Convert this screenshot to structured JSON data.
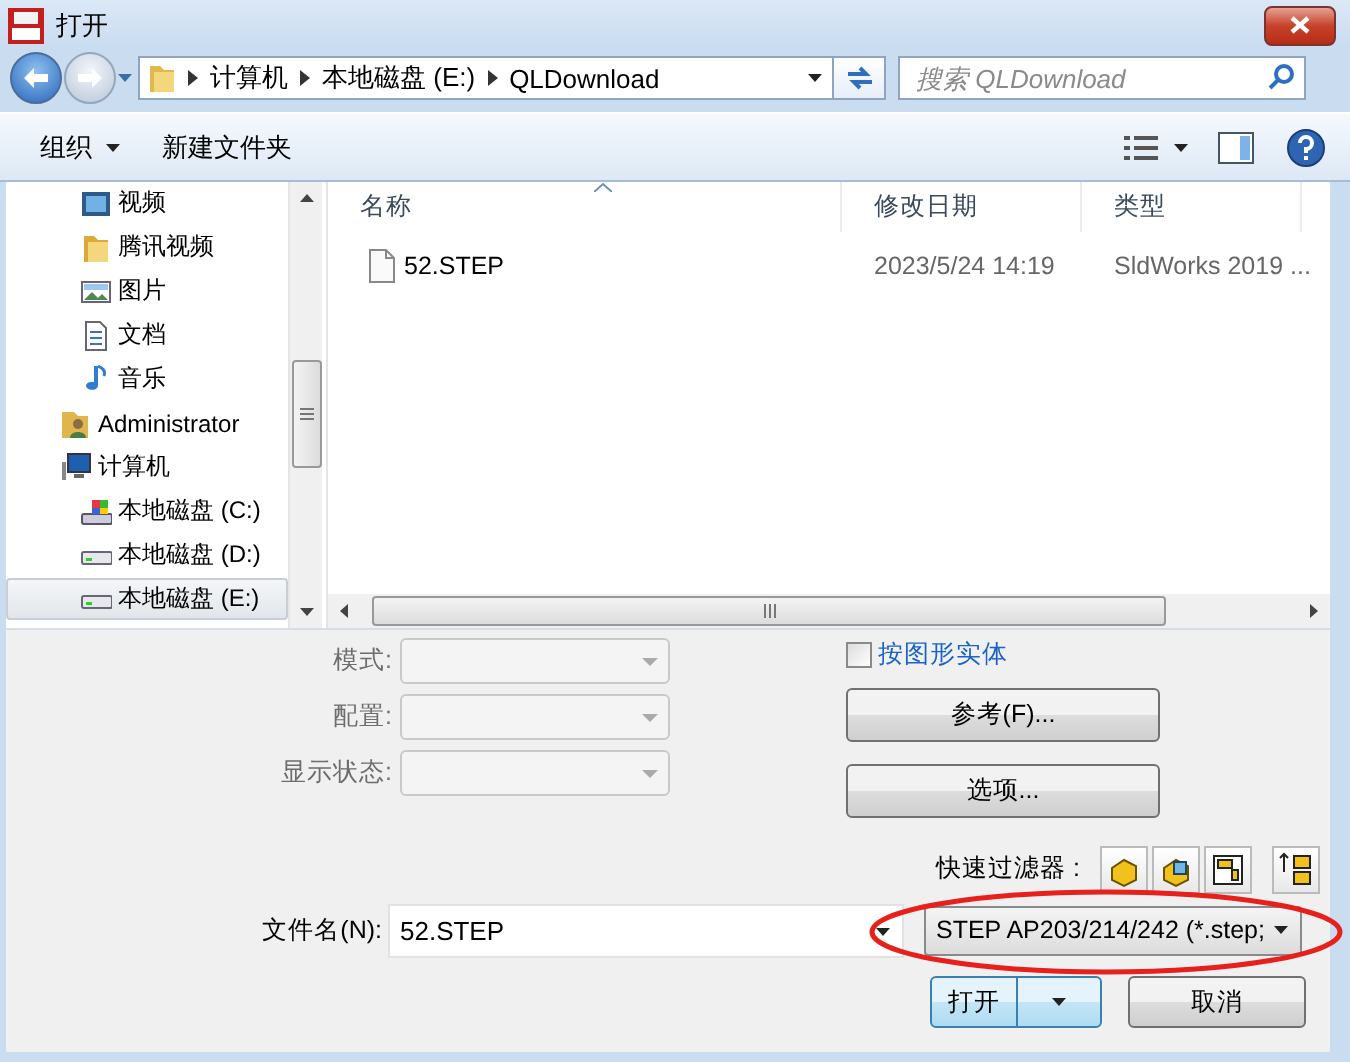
{
  "window": {
    "title": "打开"
  },
  "address": {
    "crumbs": [
      "计算机",
      "本地磁盘 (E:)",
      "QLDownload"
    ]
  },
  "search": {
    "placeholder": "搜索 QLDownload"
  },
  "toolbar": {
    "organize": "组织",
    "new_folder": "新建文件夹"
  },
  "sidebar": {
    "library_items": [
      {
        "label": "视频",
        "kind": "video",
        "selected": false
      },
      {
        "label": "腾讯视频",
        "kind": "folder",
        "selected": false
      },
      {
        "label": "图片",
        "kind": "pictures",
        "selected": false
      },
      {
        "label": "文档",
        "kind": "documents",
        "selected": false
      },
      {
        "label": "音乐",
        "kind": "music",
        "selected": false
      }
    ],
    "items": [
      {
        "label": "Administrator",
        "kind": "user",
        "selected": false
      },
      {
        "label": "计算机",
        "kind": "computer",
        "selected": false,
        "children": [
          {
            "label": "本地磁盘 (C:)",
            "kind": "system-drive",
            "selected": false
          },
          {
            "label": "本地磁盘 (D:)",
            "kind": "drive",
            "selected": false
          },
          {
            "label": "本地磁盘 (E:)",
            "kind": "drive",
            "selected": true
          }
        ]
      }
    ]
  },
  "file_list": {
    "columns": [
      "名称",
      "修改日期",
      "类型"
    ],
    "rows": [
      {
        "cells": [
          "52.STEP",
          "2023/5/24 14:19",
          "SldWorks 2019 ..."
        ]
      }
    ]
  },
  "options": {
    "fields": [
      {
        "label": "模式:",
        "disabled": true
      },
      {
        "label": "配置:",
        "disabled": true
      },
      {
        "label": "显示状态:",
        "disabled": true
      }
    ],
    "checkbox": {
      "label": "按图形实体",
      "checked": false
    },
    "buttons": [
      "参考(F)...",
      "选项..."
    ],
    "quick_filter": {
      "label": "快速过滤器 :"
    }
  },
  "filename": {
    "label": "文件名(N):",
    "value": "52.STEP"
  },
  "filetype": {
    "value": "STEP AP203/214/242 (*.step;"
  },
  "actions": [
    {
      "label": "打开",
      "kind": "split"
    },
    {
      "label": "取消",
      "kind": "plain"
    }
  ]
}
